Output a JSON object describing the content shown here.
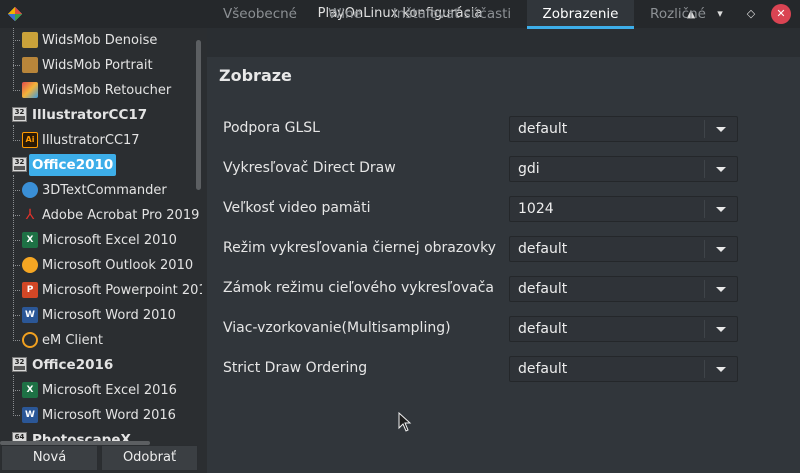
{
  "window": {
    "title": "PlayOnLinux konfigurácia"
  },
  "sidebar": {
    "items": [
      {
        "label": "WidsMob Denoise",
        "type": "app",
        "icon": "widsmob-denoise-icon"
      },
      {
        "label": "WidsMob Portrait",
        "type": "app",
        "icon": "widsmob-portrait-icon"
      },
      {
        "label": "WidsMob Retoucher",
        "type": "app",
        "icon": "widsmob-retoucher-icon"
      },
      {
        "label": "IllustratorCC17",
        "type": "group",
        "badge": "32"
      },
      {
        "label": "IllustratorCC17",
        "type": "app",
        "icon": "illustrator-icon"
      },
      {
        "label": "Office2010",
        "type": "group",
        "badge": "32",
        "selected": true
      },
      {
        "label": "3DTextCommander",
        "type": "app",
        "icon": "3dtextcommander-icon"
      },
      {
        "label": "Adobe Acrobat Pro 2019",
        "type": "app",
        "icon": "acrobat-icon"
      },
      {
        "label": "Microsoft Excel 2010",
        "type": "app",
        "icon": "excel-icon"
      },
      {
        "label": "Microsoft Outlook 2010",
        "type": "app",
        "icon": "outlook-icon"
      },
      {
        "label": "Microsoft Powerpoint 201",
        "type": "app",
        "icon": "powerpoint-icon"
      },
      {
        "label": "Microsoft Word 2010",
        "type": "app",
        "icon": "word-icon"
      },
      {
        "label": "eM Client",
        "type": "app",
        "icon": "emclient-icon"
      },
      {
        "label": "Office2016",
        "type": "group",
        "badge": "32"
      },
      {
        "label": "Microsoft Excel 2016",
        "type": "app",
        "icon": "excel-icon"
      },
      {
        "label": "Microsoft Word 2016",
        "type": "app",
        "icon": "word-icon"
      },
      {
        "label": "PhotoscapeX",
        "type": "group",
        "badge": "64"
      }
    ],
    "new_button": "Nová",
    "remove_button": "Odobrať"
  },
  "tabs": [
    {
      "label": "Všeobecné",
      "active": false
    },
    {
      "label": "Wine",
      "active": false
    },
    {
      "label": "Inštalovať súčasti",
      "active": false
    },
    {
      "label": "Zobrazenie",
      "active": true
    },
    {
      "label": "Rozličné",
      "active": false
    }
  ],
  "section": {
    "title": "Zobraze"
  },
  "settings": [
    {
      "label": "Podpora GLSL",
      "value": "default"
    },
    {
      "label": "Vykresľovač Direct Draw",
      "value": "gdi"
    },
    {
      "label": "Veľkosť video pamäti",
      "value": "1024"
    },
    {
      "label": "Režim vykresľovania čiernej obrazovky",
      "value": "default"
    },
    {
      "label": "Zámok režimu cieľového vykresľovača",
      "value": "default"
    },
    {
      "label": "Viac-vzorkovanie(Multisampling)",
      "value": "default"
    },
    {
      "label": "Strict Draw Ordering",
      "value": "default"
    }
  ],
  "colors": {
    "accent": "#3daee9",
    "close": "#da4453",
    "panel": "#31363b",
    "background": "#2b2e31"
  }
}
